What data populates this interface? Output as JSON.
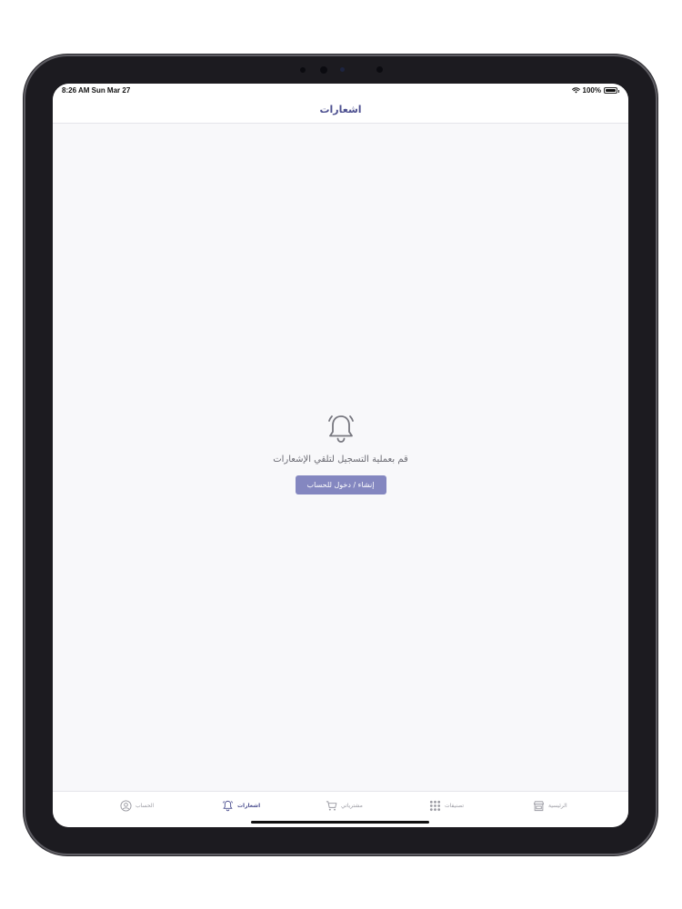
{
  "status_bar": {
    "time": "8:26 AM  Sun Mar 27",
    "battery": "100%"
  },
  "nav": {
    "title": "اشعارات"
  },
  "empty_state": {
    "icon": "bell-icon",
    "message": "قم بعملية التسجيل لتلقي الإشعارات",
    "button_label": "إنشاء / دخول للحساب"
  },
  "tabs": [
    {
      "label": "الحساب",
      "icon": "account-icon",
      "active": false
    },
    {
      "label": "اشعارات",
      "icon": "bell-icon",
      "active": true
    },
    {
      "label": "مشترياتي",
      "icon": "cart-icon",
      "active": false
    },
    {
      "label": "تصنيفات",
      "icon": "grid-icon",
      "active": false
    },
    {
      "label": "الرئيسية",
      "icon": "store-icon",
      "active": false
    }
  ],
  "colors": {
    "accent": "#4d5090",
    "button": "#8487c0",
    "background": "#f8f8fa"
  }
}
